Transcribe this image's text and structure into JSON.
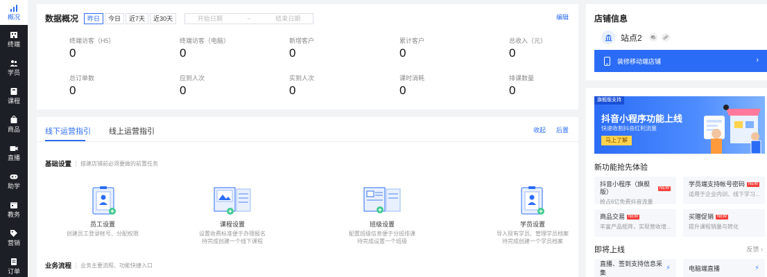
{
  "sidebar": {
    "items": [
      {
        "label": "概况",
        "icon": "chart-icon",
        "active": true
      },
      {
        "label": "终端",
        "icon": "building-icon"
      },
      {
        "label": "学员",
        "icon": "users-icon"
      },
      {
        "label": "课程",
        "icon": "book-icon"
      },
      {
        "label": "商品",
        "icon": "bag-icon"
      },
      {
        "label": "直播",
        "icon": "video-icon"
      },
      {
        "label": "助学",
        "icon": "gamepad-icon"
      },
      {
        "label": "教务",
        "icon": "calendar-icon"
      },
      {
        "label": "营销",
        "icon": "tag-icon"
      },
      {
        "label": "订单",
        "icon": "document-icon"
      }
    ]
  },
  "overview": {
    "title": "数据概况",
    "ranges": [
      "昨日",
      "今日",
      "近7天",
      "近30天"
    ],
    "date_start": "开始日期",
    "date_sep": "~",
    "date_end": "结束日期",
    "edit": "编辑",
    "stats": [
      {
        "label": "终端访客（H5）",
        "value": "0"
      },
      {
        "label": "终端访客（电脑）",
        "value": "0"
      },
      {
        "label": "新增客户",
        "value": "0"
      },
      {
        "label": "累计客户",
        "value": "0"
      },
      {
        "label": "总收入（元）",
        "value": "0"
      },
      {
        "label": "总订单数",
        "value": "0"
      },
      {
        "label": "应到人次",
        "value": "0"
      },
      {
        "label": "实到人次",
        "value": "0"
      },
      {
        "label": "课时消耗",
        "value": "0"
      },
      {
        "label": "排课数量",
        "value": "0"
      }
    ]
  },
  "guide": {
    "tabs": [
      "线下运营指引",
      "线上运营指引"
    ],
    "collapse": "收起",
    "later": "后置",
    "basic": {
      "title": "基础设置",
      "desc": "搭建店铺前必须要做的前置任务"
    },
    "cards": [
      {
        "name": "员工设置",
        "desc1": "创建员工登录帐号、分配权限",
        "desc2": ""
      },
      {
        "name": "课程设置",
        "desc1": "设置收费标准便于办理报名",
        "desc2": "待完成创建一个线下课程"
      },
      {
        "name": "班级设置",
        "desc1": "配置班级信息便于分班排课",
        "desc2": "待完成设置一个班级"
      },
      {
        "name": "学员设置",
        "desc1": "导入现有学员、管理学员档案",
        "desc2": "待完成创建一个学员档案"
      }
    ],
    "flow": {
      "title": "业务流程",
      "desc": "业务主要流程、功能快捷入口"
    }
  },
  "shop": {
    "title": "店铺信息",
    "name": "站点2",
    "decorate": "装修移动端店铺",
    "arrow": "›"
  },
  "promo": {
    "tag": "旗舰版支持",
    "title": "抖音小程序功能上线",
    "subtitle": "快速收割抖音红利流量",
    "button": "马上了解"
  },
  "features": {
    "title": "新功能抢先体验",
    "new_badge": "NEW",
    "items": [
      {
        "name": "抖音小程序（旗舰版）",
        "desc": "抢占6亿免费抖音流量"
      },
      {
        "name": "学员端支持帐号密码",
        "desc": "适用于企业内训、线下学习..."
      },
      {
        "name": "商品交易",
        "desc": "丰富产品矩阵，实现营收增..."
      },
      {
        "name": "买赠促销",
        "desc": "提升课程销量与转化"
      }
    ]
  },
  "upcoming": {
    "title": "即将上线",
    "feedback": "反馈 ›",
    "items": [
      "直播、签到支持信息采集",
      "电脑端直播"
    ]
  }
}
